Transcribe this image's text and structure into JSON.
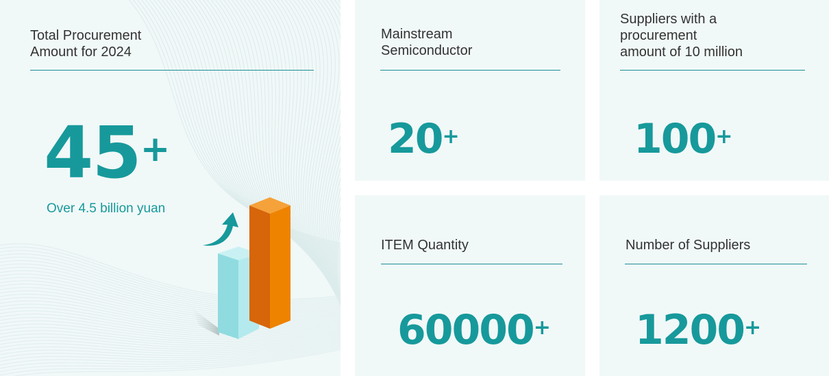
{
  "total": {
    "title": "Total Procurement\n Amount for 2024",
    "value": "45",
    "suffix": "+",
    "subtitle": "Over 4.5 billion yuan"
  },
  "stats": [
    {
      "title": "Mainstream\nSemiconductor",
      "value": "20",
      "suffix": "+"
    },
    {
      "title": "Suppliers with a\nprocurement\namount of 10 million",
      "value": "100",
      "suffix": "+"
    },
    {
      "title": "ITEM Quantity",
      "value": "60000",
      "suffix": "+"
    },
    {
      "title": "Number of Suppliers",
      "value": "1200",
      "suffix": "+"
    }
  ],
  "colors": {
    "accent": "#17999b",
    "card_bg": "#f1f8f8",
    "bar_orange": "#ee7d00",
    "bar_cyan": "#9fe3e6"
  }
}
